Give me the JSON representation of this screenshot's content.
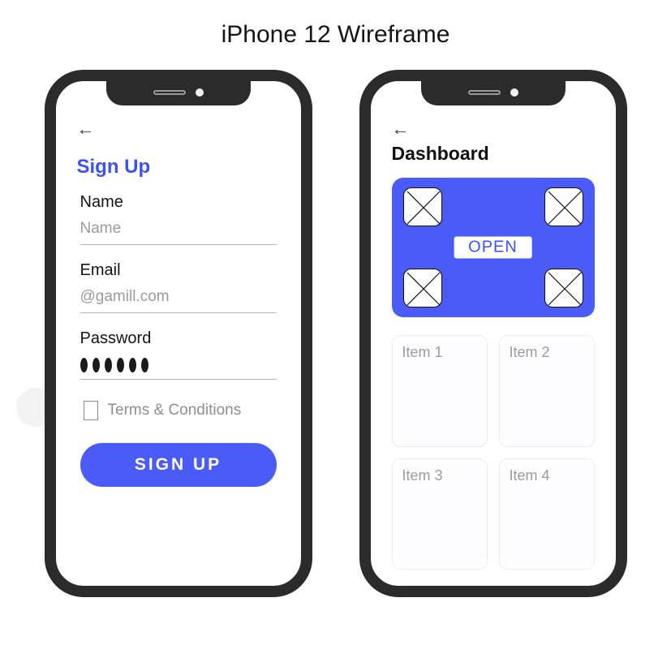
{
  "page_title": "iPhone 12 Wireframe",
  "signup": {
    "title": "Sign Up",
    "name_label": "Name",
    "name_placeholder": "Name",
    "email_label": "Email",
    "email_placeholder": "@gamill.com",
    "password_label": "Password",
    "terms_label": "Terms & Conditions",
    "button_label": "SIGN  UP",
    "password_dots": 6
  },
  "dashboard": {
    "title": "Dashboard",
    "open_label": "OPEN",
    "items": [
      "Item 1",
      "Item 2",
      "Item 3",
      "Item 4"
    ]
  }
}
